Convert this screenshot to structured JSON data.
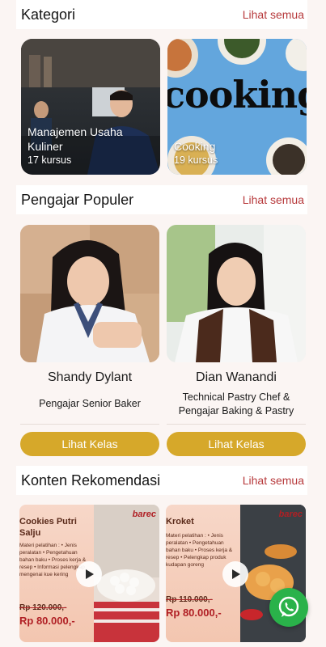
{
  "kategori": {
    "title": "Kategori",
    "see_all": "Lihat semua",
    "items": [
      {
        "title_line1": "Manajemen Usaha",
        "title_line2": "Kuliner",
        "count": "17 kursus"
      },
      {
        "title_line1": "Cooking",
        "title_line2": "",
        "count": "19 kursus",
        "banner_text": "cooking"
      }
    ]
  },
  "pengajar": {
    "title": "Pengajar Populer",
    "see_all": "Lihat semua",
    "items": [
      {
        "name": "Shandy Dylant",
        "role_line1": "Pengajar Senior Baker",
        "role_line2": "",
        "button": "Lihat Kelas"
      },
      {
        "name": "Dian Wanandi",
        "role_line1": "Technical Pastry Chef &",
        "role_line2": "Pengajar Baking & Pastry",
        "button": "Lihat Kelas"
      }
    ]
  },
  "rekomendasi": {
    "title": "Konten Rekomendasi",
    "see_all": "Lihat semua",
    "items": [
      {
        "title": "Cookies Putri Salju",
        "brand": "barec",
        "sub": "Materi pelatihan : • Jenis peralatan • Pengetahuan bahan baku • Proses kerja & resep • Informasi pelengkap mengenai kue kering",
        "old_price": "Rp 120.000,-",
        "new_price": "Rp 80.000,-"
      },
      {
        "title": "Kroket",
        "brand": "barec",
        "sub": "Materi pelatihan : • Jenis peralatan • Pengetahuan bahan baku • Proses kerja & resep • Pelengkap produk kudapan goreng",
        "old_price": "Rp 110.000,-",
        "new_price": "Rp 80.000,-"
      }
    ]
  },
  "colors": {
    "accent": "#d6a82a",
    "link": "#b73a3c",
    "whatsapp": "#2ab24a"
  },
  "icons": [
    "play-icon",
    "whatsapp-icon"
  ]
}
